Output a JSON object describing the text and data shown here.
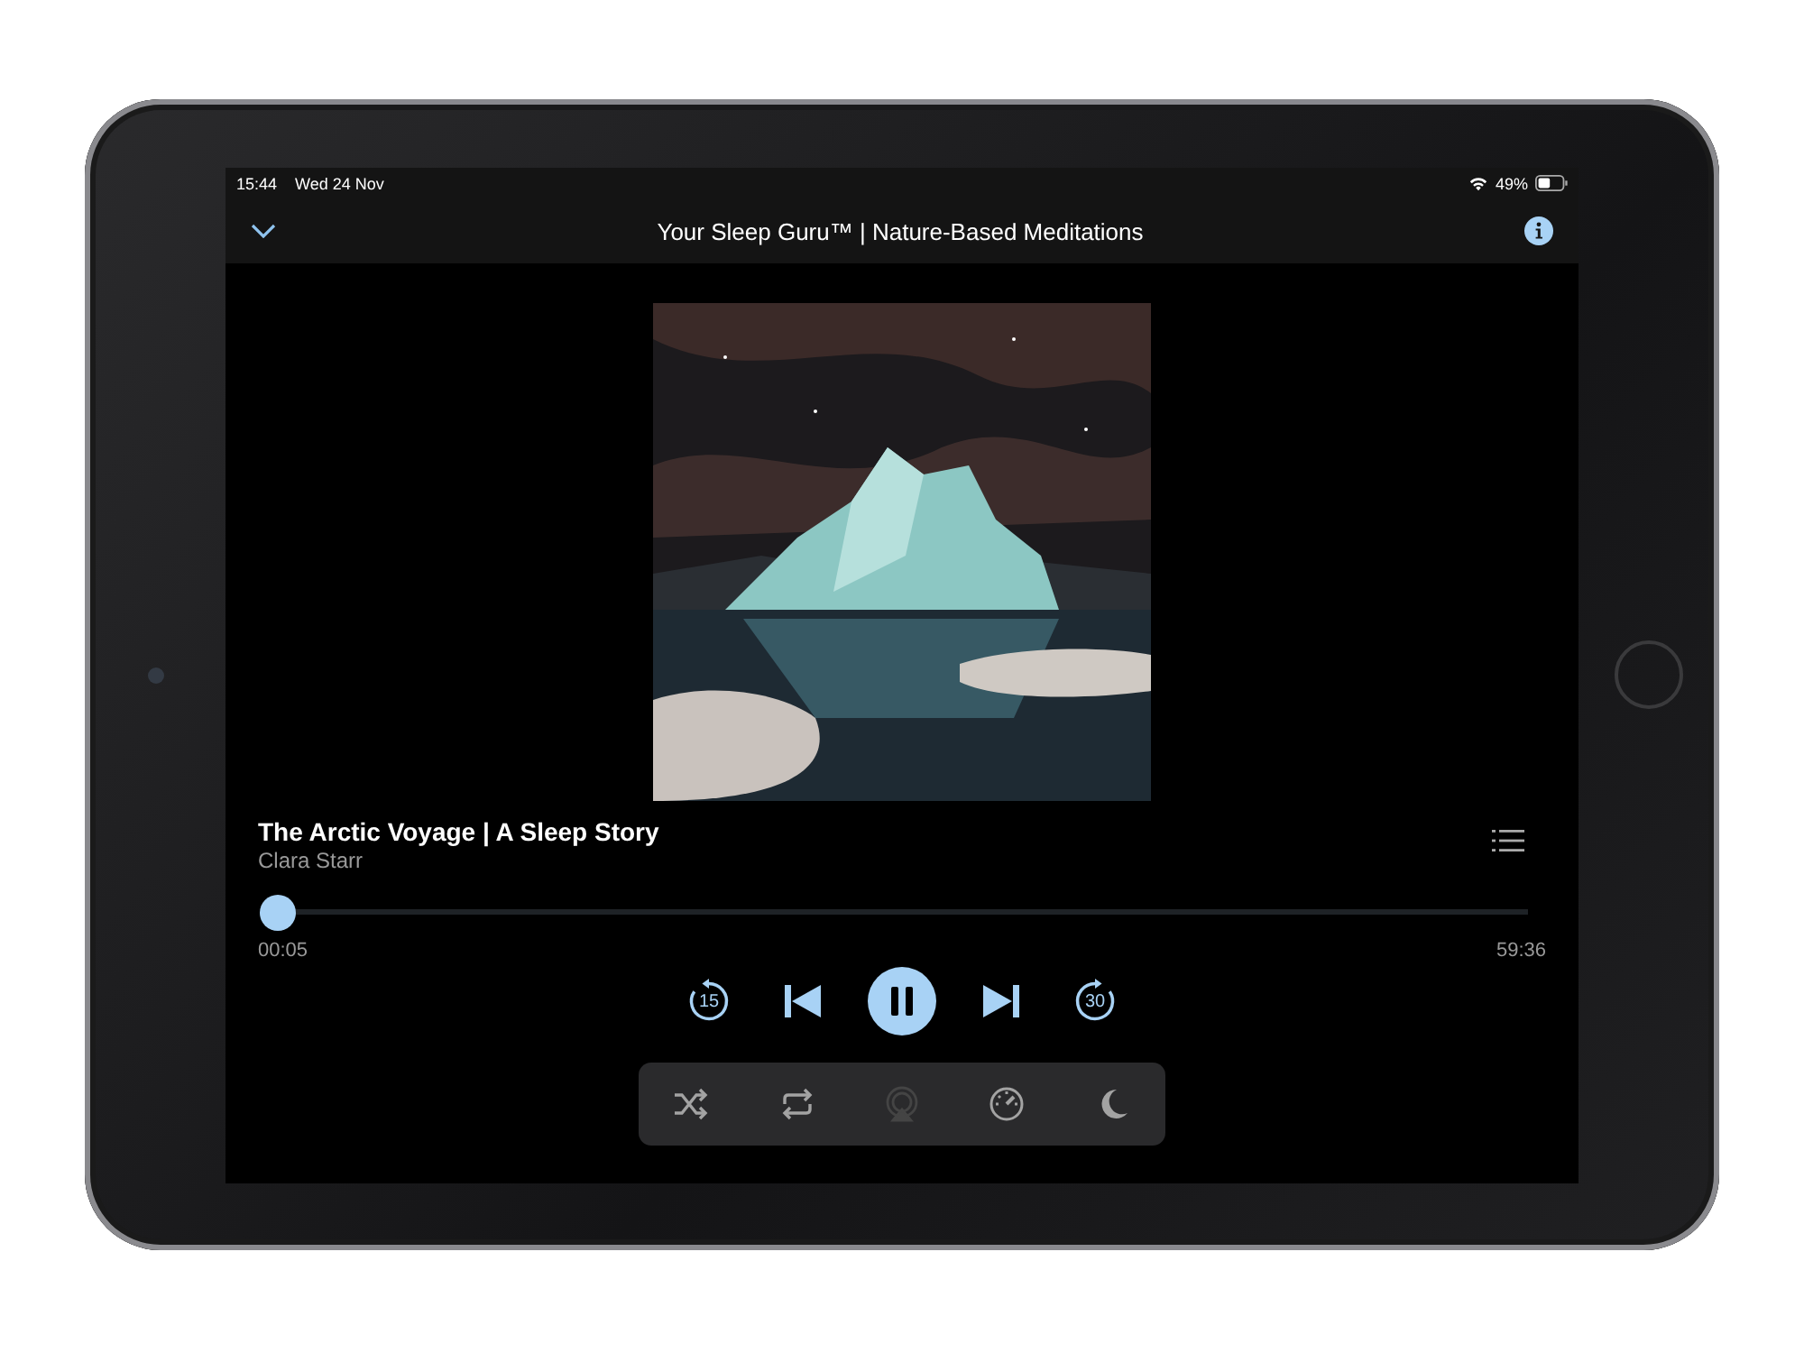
{
  "status_bar": {
    "time": "15:44",
    "date": "Wed 24 Nov",
    "battery": "49%"
  },
  "nav": {
    "title": "Your Sleep Guru™ | Nature-Based Meditations"
  },
  "track": {
    "title": "The Arctic Voyage | A Sleep Story",
    "artist": "Clara Starr"
  },
  "progress": {
    "level": 0.0014,
    "elapsed": "00:05",
    "remaining": "59:36"
  },
  "transport": {
    "skip_back": "15",
    "skip_forward": "30",
    "playing": true
  },
  "toolbar": [
    {
      "kind": "shuffle",
      "disabled": false
    },
    {
      "kind": "repeat",
      "disabled": false
    },
    {
      "kind": "airplay",
      "disabled": true
    },
    {
      "kind": "speed",
      "disabled": false
    },
    {
      "kind": "sleep",
      "disabled": false
    }
  ]
}
